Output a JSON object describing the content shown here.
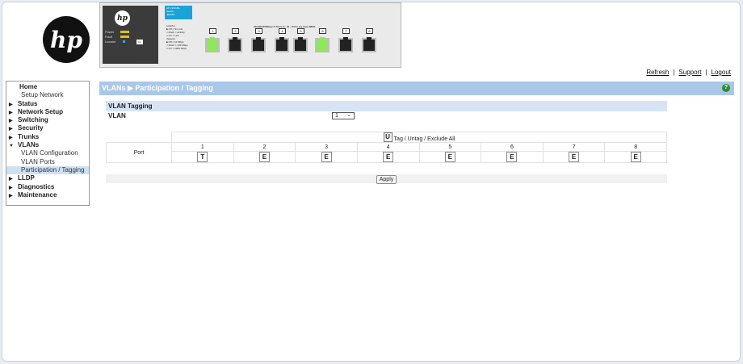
{
  "brand": {
    "logo_text": "hp"
  },
  "device": {
    "model_lines": [
      "HP 1910-8G",
      "Switch",
      "JE005A"
    ],
    "leds": [
      "Power",
      "Fault",
      "Locator"
    ],
    "fn_button": "Fn",
    "reset_clear": "○ Reset  ○ Clear",
    "legend_lines": [
      "Link/Act",
      "■ Off = No Link",
      "□ Flash = Activity",
      "□ On = Link",
      "•Speed•",
      "■ Off = 10 Mbps",
      "□ Flash = 100 Mbps",
      "□ On = 1000 Mbps"
    ],
    "ports_title": "10/100/1000Base-T Ports (1 - 8) – Ports are Auto-MDIX",
    "ports": [
      {
        "num": "1",
        "up": true
      },
      {
        "num": "2",
        "up": false
      },
      {
        "num": "3",
        "up": false
      },
      {
        "num": "4",
        "up": false
      },
      {
        "num": "5",
        "up": false
      },
      {
        "num": "6",
        "up": true
      },
      {
        "num": "7",
        "up": false
      },
      {
        "num": "8",
        "up": false
      }
    ]
  },
  "top_links": {
    "refresh": "Refresh",
    "support": "Support",
    "logout": "Logout",
    "sep": "|"
  },
  "nav": [
    {
      "label": "Home",
      "kind": "plain"
    },
    {
      "label": "Setup Network",
      "kind": "sub"
    },
    {
      "label": "Status",
      "kind": "top",
      "icon": "▶"
    },
    {
      "label": "Network Setup",
      "kind": "top",
      "icon": "▶"
    },
    {
      "label": "Switching",
      "kind": "top",
      "icon": "▶"
    },
    {
      "label": "Security",
      "kind": "top",
      "icon": "▶"
    },
    {
      "label": "Trunks",
      "kind": "top",
      "icon": "▶"
    },
    {
      "label": "VLANs",
      "kind": "top",
      "icon": "▼"
    },
    {
      "label": "VLAN Configuration",
      "kind": "sub"
    },
    {
      "label": "VLAN Ports",
      "kind": "sub"
    },
    {
      "label": "Participation / Tagging",
      "kind": "sub",
      "selected": true
    },
    {
      "label": "LLDP",
      "kind": "top",
      "icon": "▶"
    },
    {
      "label": "Diagnostics",
      "kind": "top",
      "icon": "▶"
    },
    {
      "label": "Maintenance",
      "kind": "top",
      "icon": "▶"
    }
  ],
  "page": {
    "title": "VLANs ▶ Participation / Tagging",
    "help": "?"
  },
  "section": {
    "heading": "VLAN Tagging",
    "vlan_label": "VLAN",
    "vlan_value": "1"
  },
  "table": {
    "all_button": "U",
    "all_text": "Tag / Untag / Exclude All",
    "port_header": "Port",
    "ports": [
      "1",
      "2",
      "3",
      "4",
      "5",
      "6",
      "7",
      "8"
    ],
    "states": [
      "T",
      "E",
      "E",
      "E",
      "E",
      "E",
      "E",
      "E"
    ]
  },
  "apply_label": "Apply"
}
